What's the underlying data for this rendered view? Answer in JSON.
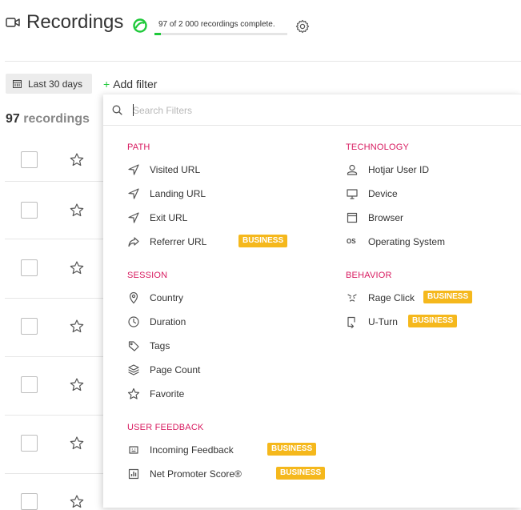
{
  "header": {
    "title": "Recordings",
    "progress_text": "97 of 2 000 recordings complete.",
    "progress_fraction": 0.0485,
    "accent_color": "#1fc93a"
  },
  "toolbar": {
    "date_range": "Last 30 days",
    "add_filter": "Add filter"
  },
  "list": {
    "count_number": "97",
    "count_word": "recordings",
    "row_count": 7
  },
  "filter_panel": {
    "search_placeholder": "Search Filters",
    "badge_color": "#f5b81c",
    "section_color": "#d81b60",
    "sections": [
      {
        "title": "PATH",
        "items": [
          {
            "label": "Visited URL",
            "icon": "navigation-arrow-icon"
          },
          {
            "label": "Landing URL",
            "icon": "navigation-arrow-icon"
          },
          {
            "label": "Exit URL",
            "icon": "navigation-arrow-icon"
          },
          {
            "label": "Referrer URL",
            "icon": "share-arrow-icon",
            "badge": "BUSINESS"
          }
        ]
      },
      {
        "title": "SESSION",
        "items": [
          {
            "label": "Country",
            "icon": "map-pin-icon"
          },
          {
            "label": "Duration",
            "icon": "clock-icon"
          },
          {
            "label": "Tags",
            "icon": "tag-icon"
          },
          {
            "label": "Page Count",
            "icon": "layers-icon"
          },
          {
            "label": "Favorite",
            "icon": "star-icon"
          }
        ]
      },
      {
        "title": "USER FEEDBACK",
        "items": [
          {
            "label": "Incoming Feedback",
            "icon": "feedback-face-icon",
            "badge": "BUSINESS"
          },
          {
            "label": "Net Promoter Score®",
            "icon": "bar-chart-icon",
            "badge": "BUSINESS"
          }
        ]
      },
      {
        "title": "TECHNOLOGY",
        "items": [
          {
            "label": "Hotjar User ID",
            "icon": "user-icon"
          },
          {
            "label": "Device",
            "icon": "monitor-icon"
          },
          {
            "label": "Browser",
            "icon": "browser-window-icon"
          },
          {
            "label": "Operating System",
            "icon": "os-icon",
            "glyph": "OS"
          }
        ]
      },
      {
        "title": "BEHAVIOR",
        "items": [
          {
            "label": "Rage Click",
            "icon": "rage-face-icon",
            "badge": "BUSINESS"
          },
          {
            "label": "U-Turn",
            "icon": "u-turn-icon",
            "badge": "BUSINESS"
          }
        ]
      }
    ]
  }
}
